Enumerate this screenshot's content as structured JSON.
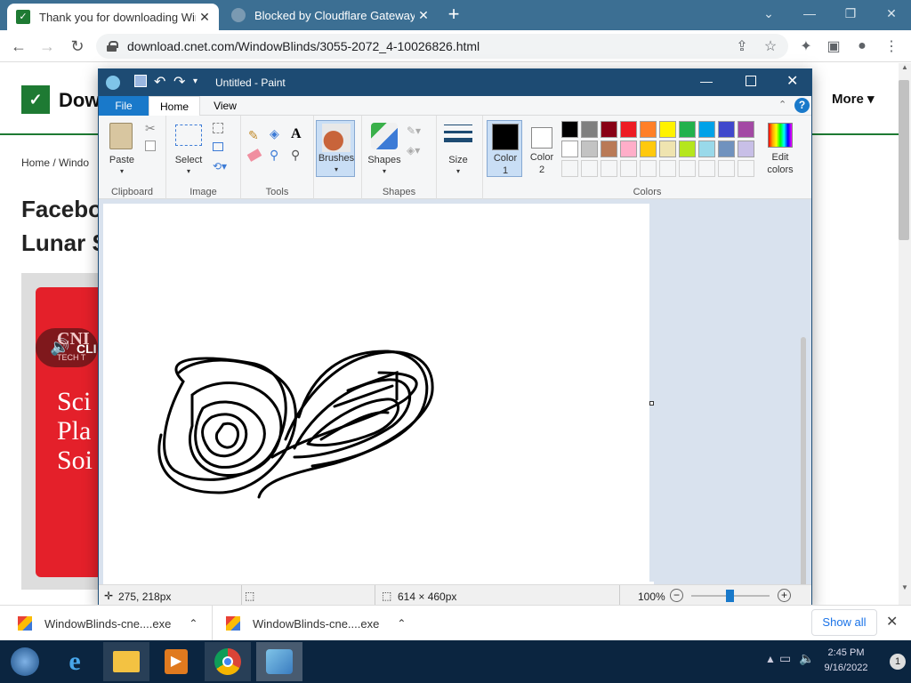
{
  "browser": {
    "tabs": [
      {
        "title": "Thank you for downloading WindowBlinds",
        "active": true
      },
      {
        "title": "Blocked by Cloudflare Gateway",
        "active": false
      }
    ],
    "new_tab": "+",
    "url": "download.cnet.com/WindowBlinds/3055-2072_4-10026826.html"
  },
  "page": {
    "logo_text": "Dow",
    "more": "More",
    "breadcrumbs": "Home  /  Windo",
    "headline_1": "Facebo",
    "headline_2": "Lunar S",
    "ad_tag": "CLI",
    "ad_brand": "CNI",
    "ad_sub": "TECH T",
    "ad_lines": [
      "Sci",
      "Pla",
      "Soi"
    ]
  },
  "paint": {
    "title": "Untitled - Paint",
    "tabs": {
      "file": "File",
      "home": "Home",
      "view": "View"
    },
    "groups": {
      "clipboard": "Clipboard",
      "image": "Image",
      "tools": "Tools",
      "shapes": "Shapes",
      "colors": "Colors"
    },
    "buttons": {
      "paste": "Paste",
      "select": "Select",
      "brushes": "Brushes",
      "shapes": "Shapes",
      "size": "Size",
      "color1_a": "Color",
      "color1_b": "1",
      "color2_a": "Color",
      "color2_b": "2",
      "edit_colors_a": "Edit",
      "edit_colors_b": "colors"
    },
    "palette_row1": [
      "#000000",
      "#7f7f7f",
      "#880015",
      "#ed1c24",
      "#ff7f27",
      "#fff200",
      "#22b14c",
      "#00a2e8",
      "#3f48cc",
      "#a349a4"
    ],
    "palette_row2": [
      "#ffffff",
      "#c3c3c3",
      "#b97a57",
      "#ffaec9",
      "#ffc90e",
      "#efe4b0",
      "#b5e61d",
      "#99d9ea",
      "#7092be",
      "#c8bfe7"
    ],
    "color1": "#000000",
    "color2": "#ffffff",
    "status": {
      "cursor": "275, 218px",
      "size": "614 × 460px",
      "zoom": "100%"
    }
  },
  "downloads": {
    "items": [
      "WindowBlinds-cne....exe",
      "WindowBlinds-cne....exe"
    ],
    "show_all": "Show all"
  },
  "taskbar": {
    "clock_time": "2:45 PM",
    "clock_date": "9/16/2022",
    "badge": "1"
  }
}
